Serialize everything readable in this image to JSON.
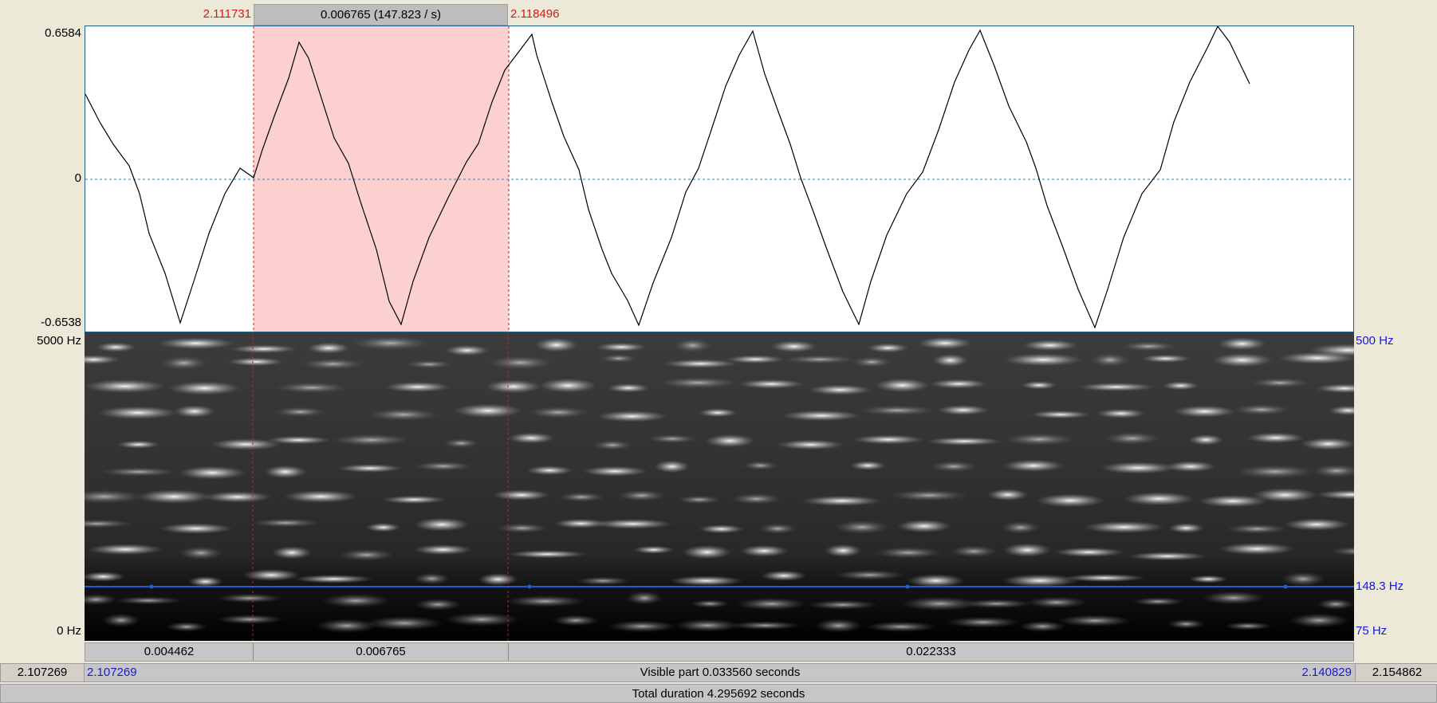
{
  "top": {
    "selection_start": "2.111731",
    "selection_duration": "0.006765 (147.823 / s)",
    "selection_end": "2.118496"
  },
  "waveform": {
    "max_label": "0.6584",
    "zero_label": "0",
    "min_label": "-0.6538",
    "line_color": "#000000",
    "zero_line_color": "#3aa0d8",
    "selection_color": "#fdd0d0",
    "cursor_color": "#d21a1a"
  },
  "spectrogram": {
    "freq_top_label": "5000 Hz",
    "freq_bottom_label": "0 Hz",
    "pitch_top_label": "500 Hz",
    "pitch_value_label": "148.3 Hz",
    "pitch_bottom_label": "75 Hz",
    "pitch_line_color": "#1f5fd6"
  },
  "intervals": {
    "before": "0.004462",
    "selection": "0.006765",
    "after": "0.022333"
  },
  "visible": {
    "window_start": "2.107269",
    "visible_start": "2.107269",
    "text": "Visible part 0.033560 seconds",
    "visible_end": "2.140829",
    "window_end": "2.154862"
  },
  "total": {
    "text": "Total duration 4.295692 seconds"
  }
}
